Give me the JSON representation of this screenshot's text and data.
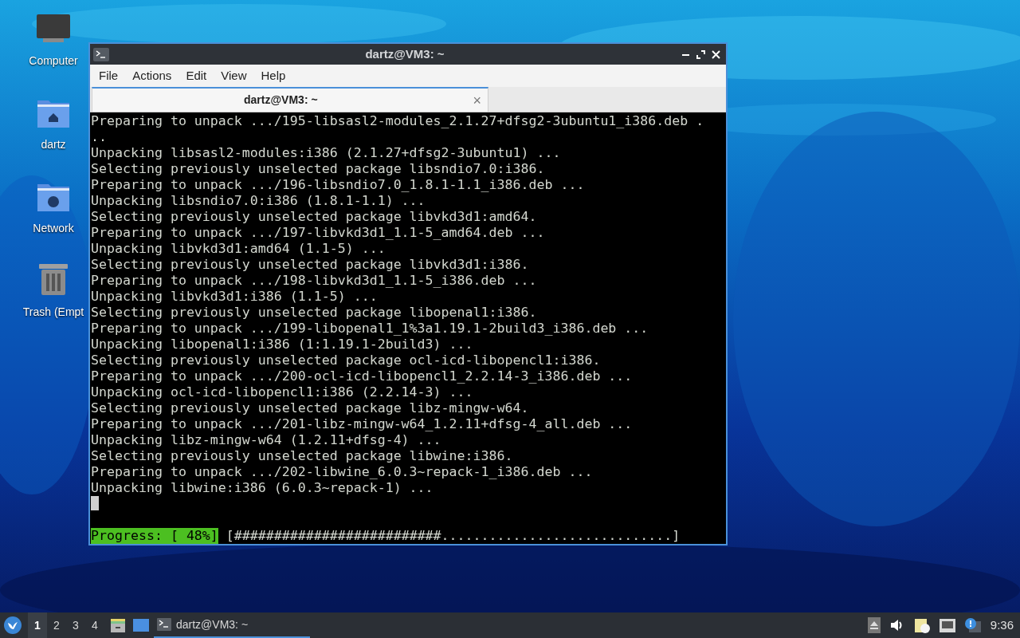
{
  "desktop_icons": [
    {
      "kind": "computer",
      "label": "Computer"
    },
    {
      "kind": "home",
      "label": "dartz"
    },
    {
      "kind": "network",
      "label": "Network"
    },
    {
      "kind": "trash",
      "label": "Trash (Empt"
    }
  ],
  "window": {
    "title": "dartz@VM3: ~",
    "menu": [
      "File",
      "Actions",
      "Edit",
      "View",
      "Help"
    ],
    "tabs": [
      {
        "label": "dartz@VM3: ~",
        "selected": true,
        "close": "×"
      }
    ],
    "terminal": {
      "lines": [
        "Preparing to unpack .../195-libsasl2-modules_2.1.27+dfsg2-3ubuntu1_i386.deb .",
        "..",
        "Unpacking libsasl2-modules:i386 (2.1.27+dfsg2-3ubuntu1) ...",
        "Selecting previously unselected package libsndio7.0:i386.",
        "Preparing to unpack .../196-libsndio7.0_1.8.1-1.1_i386.deb ...",
        "Unpacking libsndio7.0:i386 (1.8.1-1.1) ...",
        "Selecting previously unselected package libvkd3d1:amd64.",
        "Preparing to unpack .../197-libvkd3d1_1.1-5_amd64.deb ...",
        "Unpacking libvkd3d1:amd64 (1.1-5) ...",
        "Selecting previously unselected package libvkd3d1:i386.",
        "Preparing to unpack .../198-libvkd3d1_1.1-5_i386.deb ...",
        "Unpacking libvkd3d1:i386 (1.1-5) ...",
        "Selecting previously unselected package libopenal1:i386.",
        "Preparing to unpack .../199-libopenal1_1%3a1.19.1-2build3_i386.deb ...",
        "Unpacking libopenal1:i386 (1:1.19.1-2build3) ...",
        "Selecting previously unselected package ocl-icd-libopencl1:i386.",
        "Preparing to unpack .../200-ocl-icd-libopencl1_2.2.14-3_i386.deb ...",
        "Unpacking ocl-icd-libopencl1:i386 (2.2.14-3) ...",
        "Selecting previously unselected package libz-mingw-w64.",
        "Preparing to unpack .../201-libz-mingw-w64_1.2.11+dfsg-4_all.deb ...",
        "Unpacking libz-mingw-w64 (1.2.11+dfsg-4) ...",
        "Selecting previously unselected package libwine:i386.",
        "Preparing to unpack .../202-libwine_6.0.3~repack-1_i386.deb ...",
        "Unpacking libwine:i386 (6.0.3~repack-1) ..."
      ],
      "progress_label": "Progress: [ 48%]",
      "progress_bar": "[##########################.............................]"
    }
  },
  "taskbar": {
    "workspaces": [
      {
        "label": "1",
        "selected": true
      },
      {
        "label": "2",
        "selected": false
      },
      {
        "label": "3",
        "selected": false
      },
      {
        "label": "4",
        "selected": false
      }
    ],
    "task": {
      "label": "dartz@VM3: ~",
      "selected": true
    },
    "clock": "9:36"
  }
}
